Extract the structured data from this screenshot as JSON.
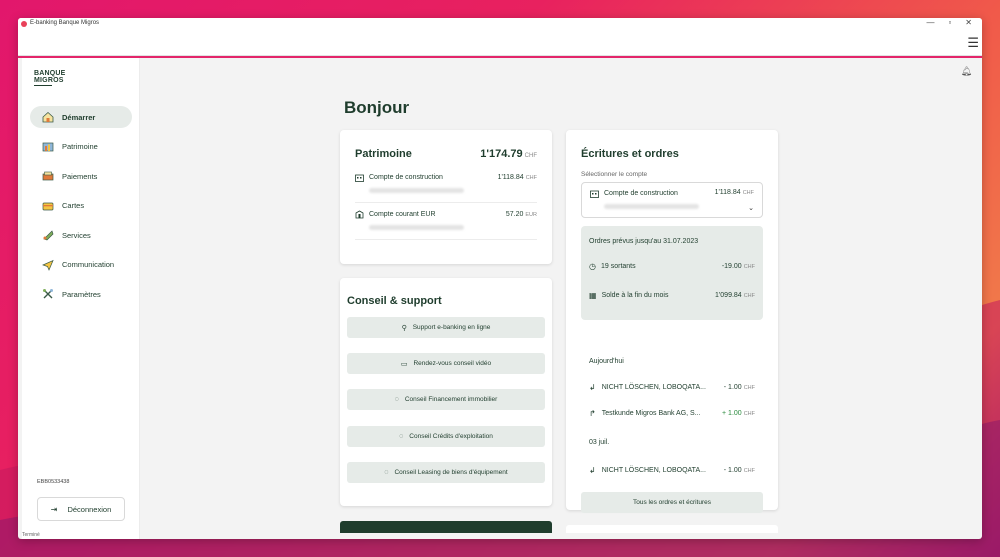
{
  "window": {
    "title": "E-banking Banque Migros"
  },
  "logo": {
    "line1": "BANQUE",
    "line2": "MIGROS"
  },
  "sidebar": {
    "items": [
      {
        "label": "Démarrer",
        "icon": "house-icon",
        "active": true
      },
      {
        "label": "Patrimoine",
        "icon": "assets-icon",
        "active": false
      },
      {
        "label": "Paiements",
        "icon": "payments-icon",
        "active": false
      },
      {
        "label": "Cartes",
        "icon": "card-icon",
        "active": false
      },
      {
        "label": "Services",
        "icon": "services-icon",
        "active": false
      },
      {
        "label": "Communication",
        "icon": "paper-plane-icon",
        "active": false
      },
      {
        "label": "Paramètres",
        "icon": "tools-icon",
        "active": false
      }
    ],
    "user_id": "EBB0533438",
    "logout_label": "Déconnexion"
  },
  "statusbar": "Terminé",
  "greeting": "Bonjour",
  "patrimoine": {
    "title": "Patrimoine",
    "total": "1'174.79",
    "currency": "CHF",
    "accounts": [
      {
        "name": "Compte de construction",
        "amount": "1'118.84",
        "currency": "CHF"
      },
      {
        "name": "Compte courant EUR",
        "amount": "57.20",
        "currency": "EUR"
      }
    ]
  },
  "conseil": {
    "title": "Conseil & support",
    "buttons": [
      {
        "label": "Support e-banking en ligne",
        "icon": "support-icon"
      },
      {
        "label": "Rendez-vous conseil vidéo",
        "icon": "calendar-icon"
      },
      {
        "label": "Conseil Financement immobilier",
        "icon": "chat-icon"
      },
      {
        "label": "Conseil Crédits d'exploitation",
        "icon": "chat-icon"
      },
      {
        "label": "Conseil Leasing de biens d'équipement",
        "icon": "chat-icon"
      }
    ]
  },
  "ecritures": {
    "title": "Écritures et ordres",
    "select_label": "Sélectionner le compte",
    "selected": {
      "name": "Compte de construction",
      "amount": "1'118.84",
      "currency": "CHF"
    },
    "planned": {
      "title": "Ordres prévus jusqu'au 31.07.2023",
      "rows": [
        {
          "label": "19 sortants",
          "amount": "-19.00",
          "currency": "CHF"
        },
        {
          "label": "Solde à la fin du mois",
          "amount": "1'099.84",
          "currency": "CHF"
        }
      ]
    },
    "groups": [
      {
        "day": "Aujourd'hui",
        "items": [
          {
            "label": "NICHT LÖSCHEN, LOBOQATA...",
            "amount": "- 1.00",
            "currency": "CHF",
            "direction": "out"
          },
          {
            "label": "Testkunde Migros Bank AG, S...",
            "amount": "+ 1.00",
            "currency": "CHF",
            "direction": "in"
          }
        ]
      },
      {
        "day": "03 juil.",
        "items": [
          {
            "label": "NICHT LÖSCHEN, LOBOQATA...",
            "amount": "- 1.00",
            "currency": "CHF",
            "direction": "out"
          }
        ]
      }
    ],
    "all_label": "Tous les ordres et écritures"
  }
}
